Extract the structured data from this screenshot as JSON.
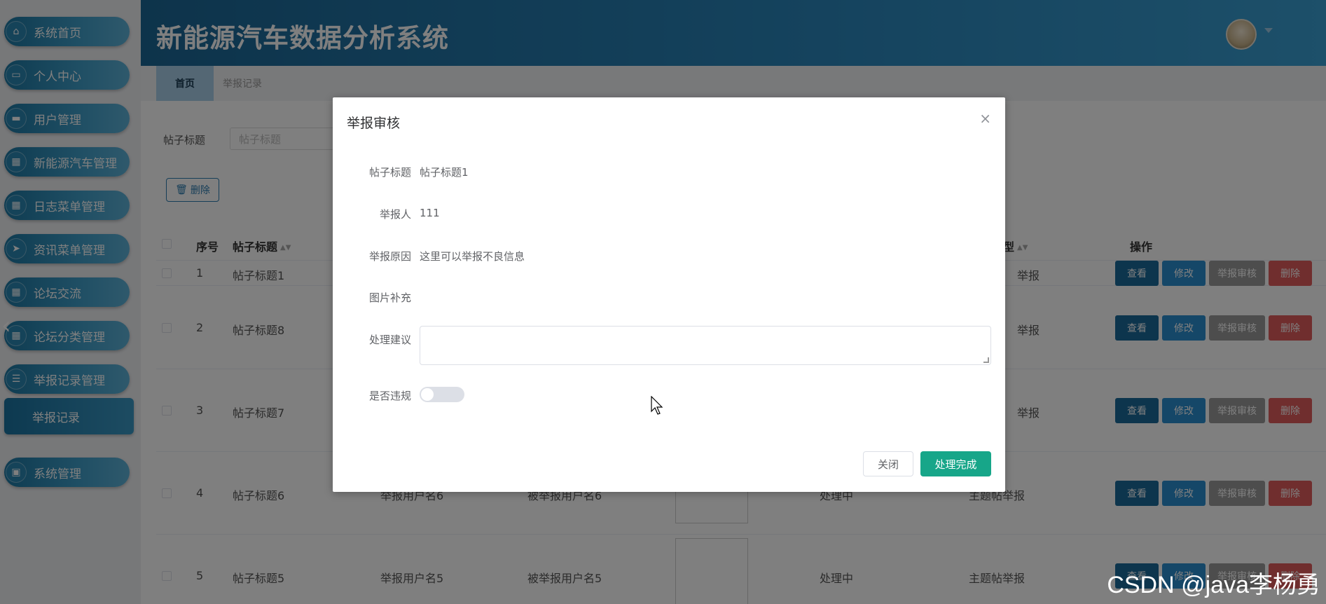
{
  "app": {
    "title": "新能源汽车数据分析系统"
  },
  "sidebar": {
    "items": [
      {
        "label": "系统首页",
        "icon": "home-icon"
      },
      {
        "label": "个人中心",
        "icon": "wallet-icon"
      },
      {
        "label": "用户管理",
        "icon": "ticket-icon"
      },
      {
        "label": "新能源汽车管理",
        "icon": "grid-icon"
      },
      {
        "label": "日志菜单管理",
        "icon": "grid-icon"
      },
      {
        "label": "资讯菜单管理",
        "icon": "send-icon"
      },
      {
        "label": "论坛交流",
        "icon": "grid-icon"
      },
      {
        "label": "论坛分类管理",
        "icon": "grid-icon"
      },
      {
        "label": "举报记录管理",
        "icon": "list-icon"
      },
      {
        "label": "系统管理",
        "icon": "briefcase-icon"
      }
    ],
    "active_sub": "举报记录"
  },
  "tabs": [
    {
      "label": "首页"
    },
    {
      "label": "举报记录"
    }
  ],
  "search": {
    "label": "帖子标题",
    "placeholder": "帖子标题"
  },
  "toolbar": {
    "delete_label": "删除"
  },
  "table": {
    "headers": {
      "index": "序号",
      "title": "帖子标题",
      "type": "型",
      "actions": "操作"
    },
    "rows": [
      {
        "index": "1",
        "title": "帖子标题1",
        "reporter": "",
        "reported": "",
        "status": "",
        "type": "举报"
      },
      {
        "index": "2",
        "title": "帖子标题8",
        "reporter": "",
        "reported": "",
        "status": "",
        "type": "举报"
      },
      {
        "index": "3",
        "title": "帖子标题7",
        "reporter": "",
        "reported": "",
        "status": "",
        "type": "举报"
      },
      {
        "index": "4",
        "title": "帖子标题6",
        "reporter": "举报用户名6",
        "reported": "被举报用户名6",
        "status": "处理中",
        "type": "主题帖举报"
      },
      {
        "index": "5",
        "title": "帖子标题5",
        "reporter": "举报用户名5",
        "reported": "被举报用户名5",
        "status": "处理中",
        "type": "主题帖举报"
      }
    ],
    "buttons": {
      "view": "查看",
      "edit": "修改",
      "audit": "举报审核",
      "delete": "删除"
    }
  },
  "dialog": {
    "title": "举报审核",
    "close_icon": "×",
    "fields": {
      "post_title": {
        "label": "帖子标题",
        "value": "帖子标题1"
      },
      "reporter": {
        "label": "举报人",
        "value": "111"
      },
      "reason": {
        "label": "举报原因",
        "value": "这里可以举报不良信息"
      },
      "image": {
        "label": "图片补充"
      },
      "suggestion": {
        "label": "处理建议",
        "value": ""
      },
      "violation": {
        "label": "是否违规",
        "on": false
      }
    },
    "close_label": "关闭",
    "done_label": "处理完成"
  },
  "watermark": "CSDN @java李杨勇",
  "colors": {
    "accent": "#2b88be",
    "done": "#17a689",
    "danger": "#e05d5d"
  }
}
